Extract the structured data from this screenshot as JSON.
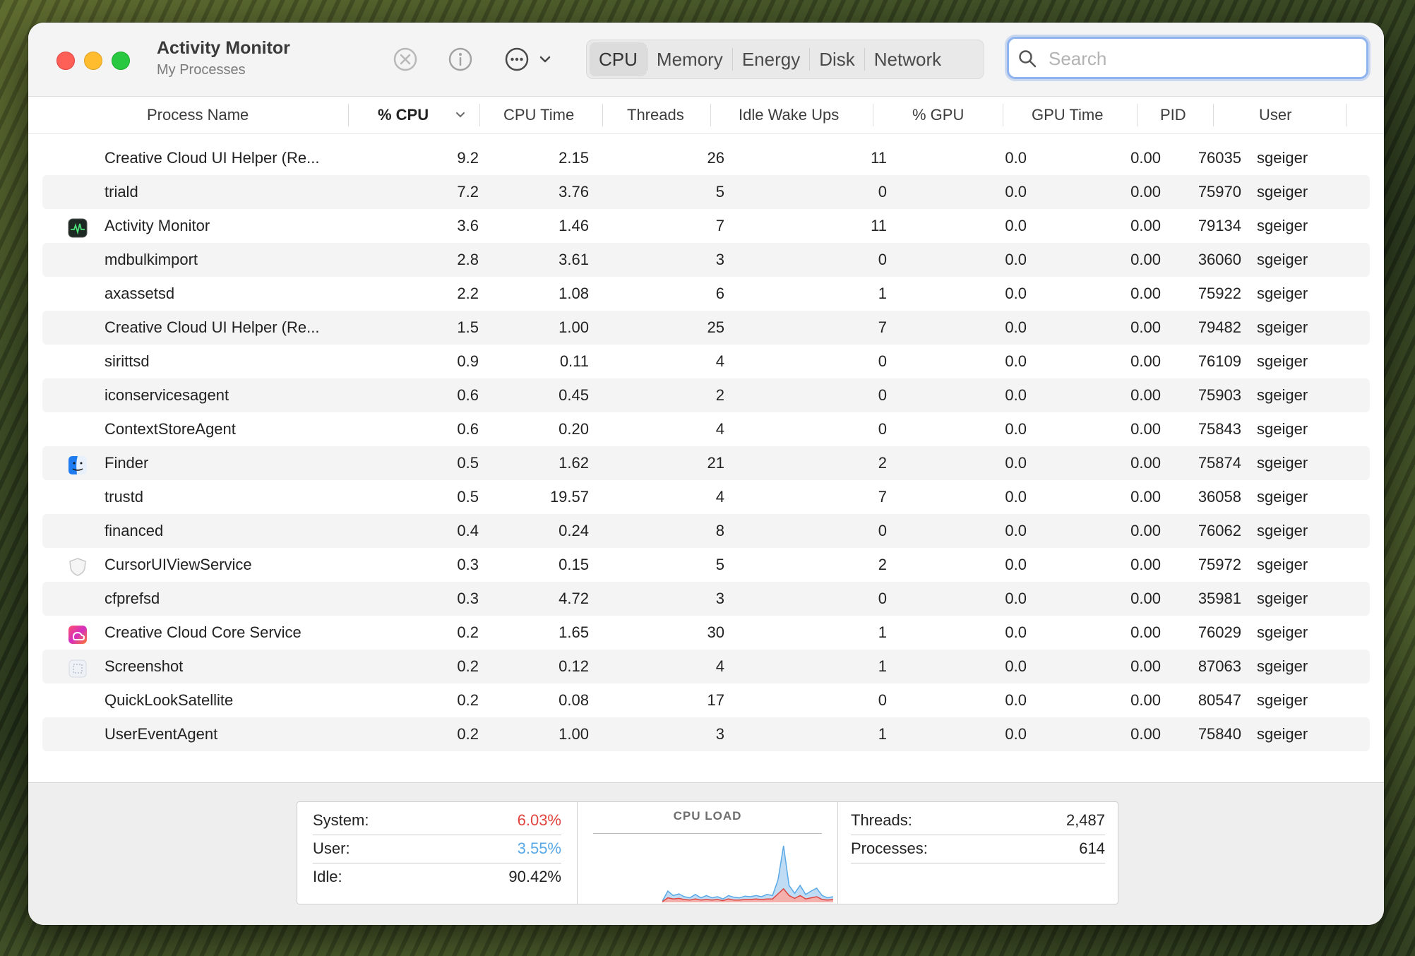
{
  "window": {
    "title": "Activity Monitor",
    "subtitle": "My Processes"
  },
  "toolbar": {
    "icons": [
      "stop-process-icon",
      "info-icon",
      "more-options-icon",
      "chevron-down-icon"
    ],
    "tabs": [
      "CPU",
      "Memory",
      "Energy",
      "Disk",
      "Network"
    ],
    "active_tab": "CPU",
    "search_placeholder": "Search",
    "search_value": ""
  },
  "table": {
    "sort_column": "% CPU",
    "columns": [
      "Process Name",
      "% CPU",
      "CPU Time",
      "Threads",
      "Idle Wake Ups",
      "% GPU",
      "GPU Time",
      "PID",
      "User"
    ],
    "rows": [
      {
        "name": "Creative Cloud UI Helper (Re...",
        "icon": "",
        "cpu": "9.2",
        "cpu_time": "2.15",
        "threads": "26",
        "idle_wake_ups": "11",
        "gpu": "0.0",
        "gpu_time": "0.00",
        "pid": "76035",
        "user": "sgeiger"
      },
      {
        "name": "triald",
        "icon": "",
        "cpu": "7.2",
        "cpu_time": "3.76",
        "threads": "5",
        "idle_wake_ups": "0",
        "gpu": "0.0",
        "gpu_time": "0.00",
        "pid": "75970",
        "user": "sgeiger"
      },
      {
        "name": "Activity Monitor",
        "icon": "activity-monitor-icon",
        "cpu": "3.6",
        "cpu_time": "1.46",
        "threads": "7",
        "idle_wake_ups": "11",
        "gpu": "0.0",
        "gpu_time": "0.00",
        "pid": "79134",
        "user": "sgeiger"
      },
      {
        "name": "mdbulkimport",
        "icon": "",
        "cpu": "2.8",
        "cpu_time": "3.61",
        "threads": "3",
        "idle_wake_ups": "0",
        "gpu": "0.0",
        "gpu_time": "0.00",
        "pid": "36060",
        "user": "sgeiger"
      },
      {
        "name": "axassetsd",
        "icon": "",
        "cpu": "2.2",
        "cpu_time": "1.08",
        "threads": "6",
        "idle_wake_ups": "1",
        "gpu": "0.0",
        "gpu_time": "0.00",
        "pid": "75922",
        "user": "sgeiger"
      },
      {
        "name": "Creative Cloud UI Helper (Re...",
        "icon": "",
        "cpu": "1.5",
        "cpu_time": "1.00",
        "threads": "25",
        "idle_wake_ups": "7",
        "gpu": "0.0",
        "gpu_time": "0.00",
        "pid": "79482",
        "user": "sgeiger"
      },
      {
        "name": "sirittsd",
        "icon": "",
        "cpu": "0.9",
        "cpu_time": "0.11",
        "threads": "4",
        "idle_wake_ups": "0",
        "gpu": "0.0",
        "gpu_time": "0.00",
        "pid": "76109",
        "user": "sgeiger"
      },
      {
        "name": "iconservicesagent",
        "icon": "",
        "cpu": "0.6",
        "cpu_time": "0.45",
        "threads": "2",
        "idle_wake_ups": "0",
        "gpu": "0.0",
        "gpu_time": "0.00",
        "pid": "75903",
        "user": "sgeiger"
      },
      {
        "name": "ContextStoreAgent",
        "icon": "",
        "cpu": "0.6",
        "cpu_time": "0.20",
        "threads": "4",
        "idle_wake_ups": "0",
        "gpu": "0.0",
        "gpu_time": "0.00",
        "pid": "75843",
        "user": "sgeiger"
      },
      {
        "name": "Finder",
        "icon": "finder-icon",
        "cpu": "0.5",
        "cpu_time": "1.62",
        "threads": "21",
        "idle_wake_ups": "2",
        "gpu": "0.0",
        "gpu_time": "0.00",
        "pid": "75874",
        "user": "sgeiger"
      },
      {
        "name": "trustd",
        "icon": "",
        "cpu": "0.5",
        "cpu_time": "19.57",
        "threads": "4",
        "idle_wake_ups": "7",
        "gpu": "0.0",
        "gpu_time": "0.00",
        "pid": "36058",
        "user": "sgeiger"
      },
      {
        "name": "financed",
        "icon": "",
        "cpu": "0.4",
        "cpu_time": "0.24",
        "threads": "8",
        "idle_wake_ups": "0",
        "gpu": "0.0",
        "gpu_time": "0.00",
        "pid": "76062",
        "user": "sgeiger"
      },
      {
        "name": "CursorUIViewService",
        "icon": "shield-icon",
        "cpu": "0.3",
        "cpu_time": "0.15",
        "threads": "5",
        "idle_wake_ups": "2",
        "gpu": "0.0",
        "gpu_time": "0.00",
        "pid": "75972",
        "user": "sgeiger"
      },
      {
        "name": "cfprefsd",
        "icon": "",
        "cpu": "0.3",
        "cpu_time": "4.72",
        "threads": "3",
        "idle_wake_ups": "0",
        "gpu": "0.0",
        "gpu_time": "0.00",
        "pid": "35981",
        "user": "sgeiger"
      },
      {
        "name": "Creative Cloud Core Service",
        "icon": "creative-cloud-icon",
        "cpu": "0.2",
        "cpu_time": "1.65",
        "threads": "30",
        "idle_wake_ups": "1",
        "gpu": "0.0",
        "gpu_time": "0.00",
        "pid": "76029",
        "user": "sgeiger"
      },
      {
        "name": "Screenshot",
        "icon": "screenshot-icon",
        "cpu": "0.2",
        "cpu_time": "0.12",
        "threads": "4",
        "idle_wake_ups": "1",
        "gpu": "0.0",
        "gpu_time": "0.00",
        "pid": "87063",
        "user": "sgeiger"
      },
      {
        "name": "QuickLookSatellite",
        "icon": "",
        "cpu": "0.2",
        "cpu_time": "0.08",
        "threads": "17",
        "idle_wake_ups": "0",
        "gpu": "0.0",
        "gpu_time": "0.00",
        "pid": "80547",
        "user": "sgeiger"
      },
      {
        "name": "UserEventAgent",
        "icon": "",
        "cpu": "0.2",
        "cpu_time": "1.00",
        "threads": "3",
        "idle_wake_ups": "1",
        "gpu": "0.0",
        "gpu_time": "0.00",
        "pid": "75840",
        "user": "sgeiger"
      }
    ]
  },
  "footer": {
    "system_label": "System:",
    "system_value": "6.03%",
    "user_label": "User:",
    "user_value": "3.55%",
    "idle_label": "Idle:",
    "idle_value": "90.42%",
    "cpu_load_title": "CPU LOAD",
    "threads_label": "Threads:",
    "threads_value": "2,487",
    "processes_label": "Processes:",
    "processes_value": "614",
    "cpu_load_user": [
      0.02,
      0.2,
      0.12,
      0.15,
      0.1,
      0.08,
      0.14,
      0.08,
      0.12,
      0.08,
      0.1,
      0.06,
      0.12,
      0.09,
      0.08,
      0.11,
      0.1,
      0.12,
      0.1,
      0.14,
      0.12,
      0.4,
      1.0,
      0.3,
      0.16,
      0.3,
      0.14,
      0.2,
      0.25,
      0.12,
      0.08,
      0.1
    ],
    "cpu_load_system": [
      0.01,
      0.08,
      0.06,
      0.07,
      0.05,
      0.04,
      0.06,
      0.04,
      0.05,
      0.04,
      0.05,
      0.03,
      0.06,
      0.04,
      0.04,
      0.05,
      0.05,
      0.06,
      0.05,
      0.06,
      0.06,
      0.15,
      0.24,
      0.12,
      0.07,
      0.12,
      0.06,
      0.08,
      0.1,
      0.05,
      0.04,
      0.05
    ],
    "colors": {
      "system": "#e0443e",
      "user": "#5aa9e6",
      "system_fill": "#f3b0ac",
      "user_fill": "#bfdcf4"
    }
  }
}
